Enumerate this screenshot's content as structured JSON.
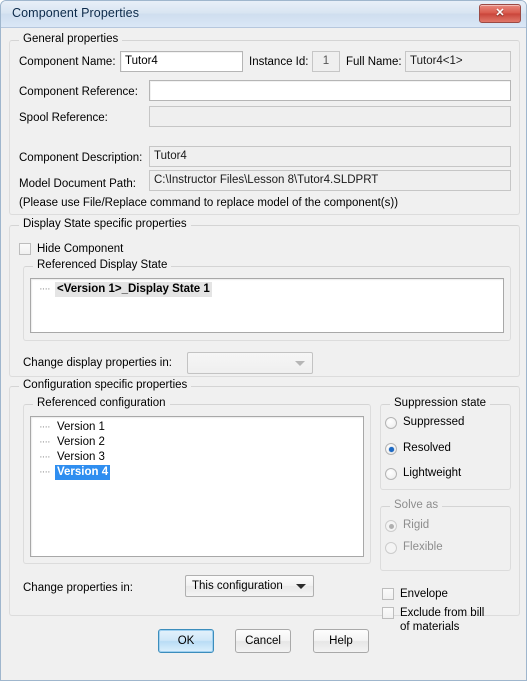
{
  "window": {
    "title": "Component Properties",
    "close_label": "✕"
  },
  "general": {
    "legend": "General properties",
    "component_name_label": "Component Name:",
    "component_name_value": "Tutor4",
    "instance_id_label": "Instance Id:",
    "instance_id_value": "1",
    "full_name_label": "Full Name:",
    "full_name_value": "Tutor4<1>",
    "component_reference_label": "Component Reference:",
    "component_reference_value": "",
    "spool_reference_label": "Spool Reference:",
    "spool_reference_value": "",
    "component_description_label": "Component Description:",
    "component_description_value": "Tutor4",
    "model_document_path_label": "Model Document Path:",
    "model_document_path_value": "C:\\Instructor Files\\Lesson 8\\Tutor4.SLDPRT",
    "replace_note": "(Please use File/Replace command to replace model of the component(s))"
  },
  "display_state": {
    "legend": "Display State specific properties",
    "hide_component_label": "Hide Component",
    "hide_component_checked": false,
    "referenced_legend": "Referenced Display State",
    "items": [
      {
        "label": "<Version 1>_Display State 1",
        "selected": true
      }
    ],
    "change_in_label": "Change display properties in:",
    "change_in_value": ""
  },
  "configuration": {
    "legend": "Configuration specific properties",
    "referenced_legend": "Referenced configuration",
    "items": [
      {
        "label": "Version 1",
        "selected": false
      },
      {
        "label": "Version 2",
        "selected": false
      },
      {
        "label": "Version 3",
        "selected": false
      },
      {
        "label": "Version 4",
        "selected": true
      }
    ],
    "change_in_label": "Change properties in:",
    "change_in_value": "This configuration"
  },
  "suppression": {
    "legend": "Suppression state",
    "options": [
      {
        "label": "Suppressed",
        "selected": false
      },
      {
        "label": "Resolved",
        "selected": true
      },
      {
        "label": "Lightweight",
        "selected": false
      }
    ]
  },
  "solve_as": {
    "legend": "Solve as",
    "disabled": true,
    "options": [
      {
        "label": "Rigid",
        "selected": true
      },
      {
        "label": "Flexible",
        "selected": false
      }
    ]
  },
  "flags": {
    "envelope_label": "Envelope",
    "envelope_checked": false,
    "exclude_bom_label": "Exclude from bill\nof materials",
    "exclude_bom_checked": false
  },
  "buttons": {
    "ok": "OK",
    "cancel": "Cancel",
    "help": "Help"
  },
  "colors": {
    "selection_blue": "#2f8ef0",
    "inactive_selection": "#e4e4e4",
    "radio_accent": "#1c69c4",
    "close_red": "#d9594c",
    "dialog_bg": "#f0f0f0"
  }
}
